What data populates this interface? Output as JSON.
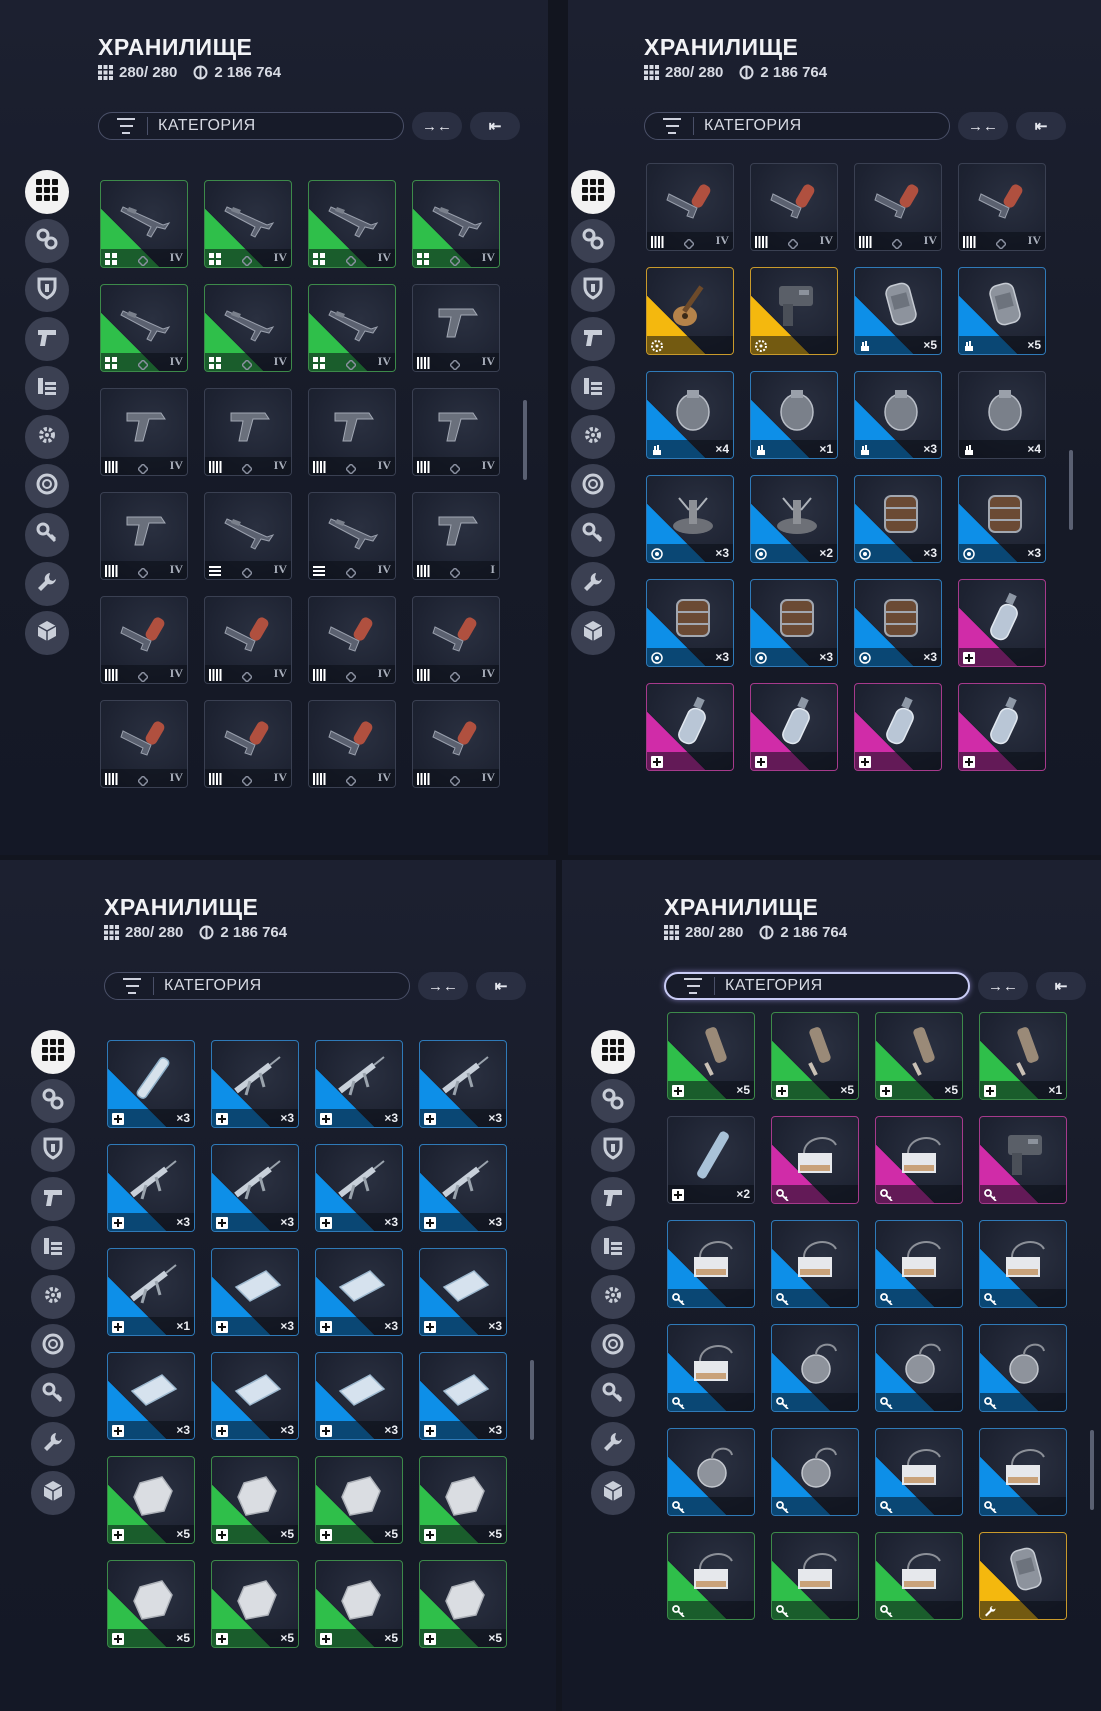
{
  "colors": {
    "green": "#2fbf4a",
    "blue": "#0d8fe8",
    "yellow": "#f4b80e",
    "pink": "#d02ca8",
    "panel": "#161a27",
    "border_green": "#3d8a4a",
    "border_blue": "#2f7ab8",
    "border_yellow": "#c99a2b",
    "border_pink": "#a63a8c"
  },
  "panels": [
    {
      "title": "ХРАНИЛИЩЕ",
      "capacity": "280/ 280",
      "credits": "2 186 764",
      "category_label": "КАТЕГОРИЯ",
      "btn_collapse": "→←",
      "btn_sort": "⇤",
      "active_category": false,
      "cells": [
        {
          "rarity": "green",
          "foot": "bars2",
          "mark": "IV",
          "count": "",
          "obj": "rifle-icon"
        },
        {
          "rarity": "green",
          "foot": "bars2",
          "mark": "IV",
          "count": "",
          "obj": "rifle-icon"
        },
        {
          "rarity": "green",
          "foot": "bars2",
          "mark": "IV",
          "count": "",
          "obj": "rifle-icon"
        },
        {
          "rarity": "green",
          "foot": "bars2",
          "mark": "IV",
          "count": "",
          "obj": "rifle-icon"
        },
        {
          "rarity": "green",
          "foot": "bars2",
          "mark": "IV",
          "count": "",
          "obj": "rifle-icon"
        },
        {
          "rarity": "green",
          "foot": "bars2",
          "mark": "IV",
          "count": "",
          "obj": "rifle-icon"
        },
        {
          "rarity": "green",
          "foot": "bars2",
          "mark": "IV",
          "count": "",
          "obj": "rifle-icon"
        },
        {
          "rarity": "none",
          "foot": "bars4",
          "mark": "IV",
          "count": "",
          "obj": "pistol-icon"
        },
        {
          "rarity": "none",
          "foot": "bars4",
          "mark": "IV",
          "count": "",
          "obj": "pistol-icon"
        },
        {
          "rarity": "none",
          "foot": "bars4",
          "mark": "IV",
          "count": "",
          "obj": "pistol-icon"
        },
        {
          "rarity": "none",
          "foot": "bars4",
          "mark": "IV",
          "count": "",
          "obj": "pistol-icon"
        },
        {
          "rarity": "none",
          "foot": "bars4",
          "mark": "IV",
          "count": "",
          "obj": "pistol-icon"
        },
        {
          "rarity": "none",
          "foot": "bars4",
          "mark": "IV",
          "count": "",
          "obj": "pistol-icon"
        },
        {
          "rarity": "none",
          "foot": "lines",
          "mark": "IV",
          "count": "",
          "obj": "rifle-icon"
        },
        {
          "rarity": "none",
          "foot": "lines",
          "mark": "IV",
          "count": "",
          "obj": "rifle-icon"
        },
        {
          "rarity": "none",
          "foot": "bars4",
          "mark": "I",
          "count": "",
          "obj": "pistol-icon"
        },
        {
          "rarity": "none",
          "foot": "bars4",
          "mark": "IV",
          "count": "",
          "obj": "flamer-icon"
        },
        {
          "rarity": "none",
          "foot": "bars4",
          "mark": "IV",
          "count": "",
          "obj": "flamer-icon"
        },
        {
          "rarity": "none",
          "foot": "bars4",
          "mark": "IV",
          "count": "",
          "obj": "flamer-icon"
        },
        {
          "rarity": "none",
          "foot": "bars4",
          "mark": "IV",
          "count": "",
          "obj": "flamer-icon"
        },
        {
          "rarity": "none",
          "foot": "bars4",
          "mark": "IV",
          "count": "",
          "obj": "flamer-icon"
        },
        {
          "rarity": "none",
          "foot": "bars4",
          "mark": "IV",
          "count": "",
          "obj": "flamer-icon"
        },
        {
          "rarity": "none",
          "foot": "bars4",
          "mark": "IV",
          "count": "",
          "obj": "flamer-icon"
        },
        {
          "rarity": "none",
          "foot": "bars4",
          "mark": "IV",
          "count": "",
          "obj": "flamer-icon"
        }
      ]
    },
    {
      "title": "ХРАНИЛИЩЕ",
      "capacity": "280/ 280",
      "credits": "2 186 764",
      "category_label": "КАТЕГОРИЯ",
      "btn_collapse": "→←",
      "btn_sort": "⇤",
      "active_category": false,
      "cells": [
        {
          "rarity": "none",
          "foot": "bars4",
          "mark": "IV",
          "count": "",
          "obj": "flamer-icon"
        },
        {
          "rarity": "none",
          "foot": "bars4",
          "mark": "IV",
          "count": "",
          "obj": "flamer-icon"
        },
        {
          "rarity": "none",
          "foot": "bars4",
          "mark": "IV",
          "count": "",
          "obj": "flamer-icon"
        },
        {
          "rarity": "none",
          "foot": "bars4",
          "mark": "IV",
          "count": "",
          "obj": "flamer-icon"
        },
        {
          "rarity": "yellow",
          "foot": "gear",
          "mark": "",
          "count": "",
          "obj": "guitar-icon"
        },
        {
          "rarity": "yellow",
          "foot": "gear",
          "mark": "",
          "count": "",
          "obj": "device-icon"
        },
        {
          "rarity": "blue",
          "foot": "hand",
          "mark": "",
          "count": "×5",
          "obj": "canister-icon"
        },
        {
          "rarity": "blue",
          "foot": "hand",
          "mark": "",
          "count": "×5",
          "obj": "canister-icon"
        },
        {
          "rarity": "blue",
          "foot": "hand",
          "mark": "",
          "count": "×4",
          "obj": "grenade-icon"
        },
        {
          "rarity": "blue",
          "foot": "hand",
          "mark": "",
          "count": "×1",
          "obj": "grenade-icon"
        },
        {
          "rarity": "blue",
          "foot": "hand",
          "mark": "",
          "count": "×3",
          "obj": "grenade-icon"
        },
        {
          "rarity": "none",
          "foot": "hand",
          "mark": "",
          "count": "×4",
          "obj": "grenade-icon"
        },
        {
          "rarity": "blue",
          "foot": "target",
          "mark": "",
          "count": "×3",
          "obj": "mine-icon"
        },
        {
          "rarity": "blue",
          "foot": "target",
          "mark": "",
          "count": "×2",
          "obj": "mine-icon"
        },
        {
          "rarity": "blue",
          "foot": "target",
          "mark": "",
          "count": "×3",
          "obj": "charge-icon"
        },
        {
          "rarity": "blue",
          "foot": "target",
          "mark": "",
          "count": "×3",
          "obj": "charge-icon"
        },
        {
          "rarity": "blue",
          "foot": "target",
          "mark": "",
          "count": "×3",
          "obj": "charge-icon"
        },
        {
          "rarity": "blue",
          "foot": "target",
          "mark": "",
          "count": "×3",
          "obj": "charge-icon"
        },
        {
          "rarity": "blue",
          "foot": "target",
          "mark": "",
          "count": "×3",
          "obj": "charge-icon"
        },
        {
          "rarity": "pink",
          "foot": "plus",
          "mark": "",
          "count": "",
          "obj": "spray-icon"
        },
        {
          "rarity": "pink",
          "foot": "plus",
          "mark": "",
          "count": "",
          "obj": "spray-icon"
        },
        {
          "rarity": "pink",
          "foot": "plus",
          "mark": "",
          "count": "",
          "obj": "spray-icon"
        },
        {
          "rarity": "pink",
          "foot": "plus",
          "mark": "",
          "count": "",
          "obj": "spray-icon"
        },
        {
          "rarity": "pink",
          "foot": "plus",
          "mark": "",
          "count": "",
          "obj": "spray-icon"
        }
      ]
    },
    {
      "title": "ХРАНИЛИЩЕ",
      "capacity": "280/ 280",
      "credits": "2 186 764",
      "category_label": "КАТЕГОРИЯ",
      "btn_collapse": "→←",
      "btn_sort": "⇤",
      "active_category": false,
      "cells": [
        {
          "rarity": "blue",
          "foot": "plus",
          "mark": "",
          "count": "×3",
          "obj": "injector-icon"
        },
        {
          "rarity": "blue",
          "foot": "plus",
          "mark": "",
          "count": "×3",
          "obj": "syringe-icon"
        },
        {
          "rarity": "blue",
          "foot": "plus",
          "mark": "",
          "count": "×3",
          "obj": "syringe-icon"
        },
        {
          "rarity": "blue",
          "foot": "plus",
          "mark": "",
          "count": "×3",
          "obj": "syringe-icon"
        },
        {
          "rarity": "blue",
          "foot": "plus",
          "mark": "",
          "count": "×3",
          "obj": "syringe-icon"
        },
        {
          "rarity": "blue",
          "foot": "plus",
          "mark": "",
          "count": "×3",
          "obj": "syringe-icon"
        },
        {
          "rarity": "blue",
          "foot": "plus",
          "mark": "",
          "count": "×3",
          "obj": "syringe-icon"
        },
        {
          "rarity": "blue",
          "foot": "plus",
          "mark": "",
          "count": "×3",
          "obj": "syringe-icon"
        },
        {
          "rarity": "blue",
          "foot": "plus",
          "mark": "",
          "count": "×1",
          "obj": "syringe-icon"
        },
        {
          "rarity": "blue",
          "foot": "plus",
          "mark": "",
          "count": "×3",
          "obj": "bandage-icon"
        },
        {
          "rarity": "blue",
          "foot": "plus",
          "mark": "",
          "count": "×3",
          "obj": "bandage-icon"
        },
        {
          "rarity": "blue",
          "foot": "plus",
          "mark": "",
          "count": "×3",
          "obj": "bandage-icon"
        },
        {
          "rarity": "blue",
          "foot": "plus",
          "mark": "",
          "count": "×3",
          "obj": "bandage-icon"
        },
        {
          "rarity": "blue",
          "foot": "plus",
          "mark": "",
          "count": "×3",
          "obj": "bandage-icon"
        },
        {
          "rarity": "blue",
          "foot": "plus",
          "mark": "",
          "count": "×3",
          "obj": "bandage-icon"
        },
        {
          "rarity": "blue",
          "foot": "plus",
          "mark": "",
          "count": "×3",
          "obj": "bandage-icon"
        },
        {
          "rarity": "green",
          "foot": "plus",
          "mark": "",
          "count": "×5",
          "obj": "gauze-icon"
        },
        {
          "rarity": "green",
          "foot": "plus",
          "mark": "",
          "count": "×5",
          "obj": "gauze-icon"
        },
        {
          "rarity": "green",
          "foot": "plus",
          "mark": "",
          "count": "×5",
          "obj": "gauze-icon"
        },
        {
          "rarity": "green",
          "foot": "plus",
          "mark": "",
          "count": "×5",
          "obj": "gauze-icon"
        },
        {
          "rarity": "green",
          "foot": "plus",
          "mark": "",
          "count": "×5",
          "obj": "gauze-icon"
        },
        {
          "rarity": "green",
          "foot": "plus",
          "mark": "",
          "count": "×5",
          "obj": "gauze-icon"
        },
        {
          "rarity": "green",
          "foot": "plus",
          "mark": "",
          "count": "×5",
          "obj": "gauze-icon"
        },
        {
          "rarity": "green",
          "foot": "plus",
          "mark": "",
          "count": "×5",
          "obj": "gauze-icon"
        }
      ]
    },
    {
      "title": "ХРАНИЛИЩЕ",
      "capacity": "280/ 280",
      "credits": "2 186 764",
      "category_label": "КАТЕГОРИЯ",
      "btn_collapse": "→←",
      "btn_sort": "⇤",
      "active_category": true,
      "cells": [
        {
          "rarity": "green",
          "foot": "plus",
          "mark": "",
          "count": "×5",
          "obj": "vial-icon"
        },
        {
          "rarity": "green",
          "foot": "plus",
          "mark": "",
          "count": "×5",
          "obj": "vial-icon"
        },
        {
          "rarity": "green",
          "foot": "plus",
          "mark": "",
          "count": "×5",
          "obj": "vial-icon"
        },
        {
          "rarity": "green",
          "foot": "plus",
          "mark": "",
          "count": "×1",
          "obj": "vial-icon"
        },
        {
          "rarity": "none",
          "foot": "plus",
          "mark": "",
          "count": "×2",
          "obj": "tube-icon"
        },
        {
          "rarity": "pink",
          "foot": "key",
          "mark": "",
          "count": "",
          "obj": "keycard-icon"
        },
        {
          "rarity": "pink",
          "foot": "key",
          "mark": "",
          "count": "",
          "obj": "keycard-icon"
        },
        {
          "rarity": "pink",
          "foot": "key",
          "mark": "",
          "count": "",
          "obj": "device-icon"
        },
        {
          "rarity": "blue",
          "foot": "key",
          "mark": "",
          "count": "",
          "obj": "keycard-icon"
        },
        {
          "rarity": "blue",
          "foot": "key",
          "mark": "",
          "count": "",
          "obj": "keycard-icon"
        },
        {
          "rarity": "blue",
          "foot": "key",
          "mark": "",
          "count": "",
          "obj": "keycard-icon"
        },
        {
          "rarity": "blue",
          "foot": "key",
          "mark": "",
          "count": "",
          "obj": "keycard-icon"
        },
        {
          "rarity": "blue",
          "foot": "key",
          "mark": "",
          "count": "",
          "obj": "keycard-icon"
        },
        {
          "rarity": "blue",
          "foot": "key",
          "mark": "",
          "count": "",
          "obj": "token-icon"
        },
        {
          "rarity": "blue",
          "foot": "key",
          "mark": "",
          "count": "",
          "obj": "token-icon"
        },
        {
          "rarity": "blue",
          "foot": "key",
          "mark": "",
          "count": "",
          "obj": "token-icon"
        },
        {
          "rarity": "blue",
          "foot": "key",
          "mark": "",
          "count": "",
          "obj": "token-icon"
        },
        {
          "rarity": "blue",
          "foot": "key",
          "mark": "",
          "count": "",
          "obj": "token-icon"
        },
        {
          "rarity": "blue",
          "foot": "key",
          "mark": "",
          "count": "",
          "obj": "keycard-icon"
        },
        {
          "rarity": "blue",
          "foot": "key",
          "mark": "",
          "count": "",
          "obj": "keycard-icon"
        },
        {
          "rarity": "green",
          "foot": "key",
          "mark": "",
          "count": "",
          "obj": "keycard-icon"
        },
        {
          "rarity": "green",
          "foot": "key",
          "mark": "",
          "count": "",
          "obj": "keycard-icon"
        },
        {
          "rarity": "green",
          "foot": "key",
          "mark": "",
          "count": "",
          "obj": "keycard-icon"
        },
        {
          "rarity": "yellow",
          "foot": "wrench",
          "mark": "",
          "count": "",
          "obj": "canister-icon"
        }
      ]
    }
  ]
}
